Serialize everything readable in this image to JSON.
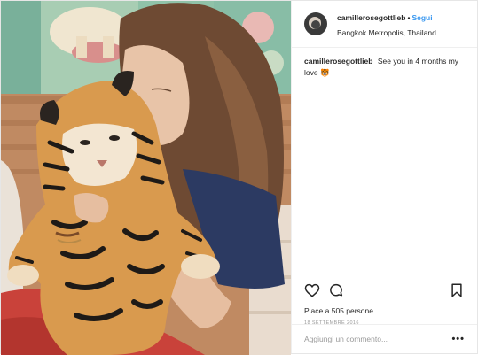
{
  "post": {
    "username": "camillerosegottlieb",
    "separator": "•",
    "follow_label": "Segui",
    "location": "Bangkok Metropolis, Thailand",
    "caption": {
      "username": "camillerosegottlieb",
      "text": "See you in 4 months my love 🐯"
    },
    "likes": "Piace a 505 persone",
    "date": "18 SETTEMBRE 2016",
    "comment_placeholder": "Aggiungi un commento...",
    "more_options": "•••"
  },
  "icons": {
    "like": "heart-icon",
    "comment": "comment-icon",
    "save": "bookmark-icon"
  },
  "colors": {
    "follow": "#3897f0",
    "text": "#262626",
    "muted": "#999999",
    "border": "#efefef"
  }
}
